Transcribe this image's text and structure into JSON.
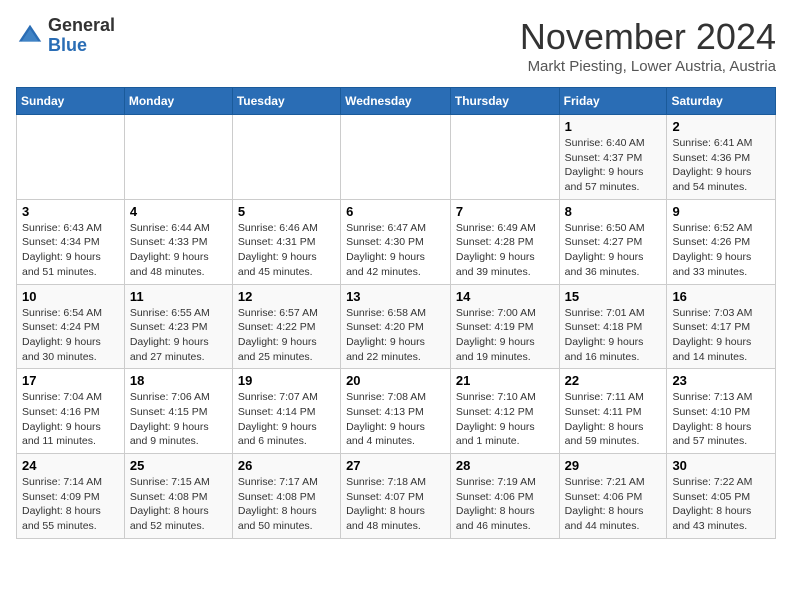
{
  "logo": {
    "general": "General",
    "blue": "Blue"
  },
  "header": {
    "month": "November 2024",
    "location": "Markt Piesting, Lower Austria, Austria"
  },
  "weekdays": [
    "Sunday",
    "Monday",
    "Tuesday",
    "Wednesday",
    "Thursday",
    "Friday",
    "Saturday"
  ],
  "weeks": [
    [
      {
        "day": "",
        "info": ""
      },
      {
        "day": "",
        "info": ""
      },
      {
        "day": "",
        "info": ""
      },
      {
        "day": "",
        "info": ""
      },
      {
        "day": "",
        "info": ""
      },
      {
        "day": "1",
        "info": "Sunrise: 6:40 AM\nSunset: 4:37 PM\nDaylight: 9 hours and 57 minutes."
      },
      {
        "day": "2",
        "info": "Sunrise: 6:41 AM\nSunset: 4:36 PM\nDaylight: 9 hours and 54 minutes."
      }
    ],
    [
      {
        "day": "3",
        "info": "Sunrise: 6:43 AM\nSunset: 4:34 PM\nDaylight: 9 hours and 51 minutes."
      },
      {
        "day": "4",
        "info": "Sunrise: 6:44 AM\nSunset: 4:33 PM\nDaylight: 9 hours and 48 minutes."
      },
      {
        "day": "5",
        "info": "Sunrise: 6:46 AM\nSunset: 4:31 PM\nDaylight: 9 hours and 45 minutes."
      },
      {
        "day": "6",
        "info": "Sunrise: 6:47 AM\nSunset: 4:30 PM\nDaylight: 9 hours and 42 minutes."
      },
      {
        "day": "7",
        "info": "Sunrise: 6:49 AM\nSunset: 4:28 PM\nDaylight: 9 hours and 39 minutes."
      },
      {
        "day": "8",
        "info": "Sunrise: 6:50 AM\nSunset: 4:27 PM\nDaylight: 9 hours and 36 minutes."
      },
      {
        "day": "9",
        "info": "Sunrise: 6:52 AM\nSunset: 4:26 PM\nDaylight: 9 hours and 33 minutes."
      }
    ],
    [
      {
        "day": "10",
        "info": "Sunrise: 6:54 AM\nSunset: 4:24 PM\nDaylight: 9 hours and 30 minutes."
      },
      {
        "day": "11",
        "info": "Sunrise: 6:55 AM\nSunset: 4:23 PM\nDaylight: 9 hours and 27 minutes."
      },
      {
        "day": "12",
        "info": "Sunrise: 6:57 AM\nSunset: 4:22 PM\nDaylight: 9 hours and 25 minutes."
      },
      {
        "day": "13",
        "info": "Sunrise: 6:58 AM\nSunset: 4:20 PM\nDaylight: 9 hours and 22 minutes."
      },
      {
        "day": "14",
        "info": "Sunrise: 7:00 AM\nSunset: 4:19 PM\nDaylight: 9 hours and 19 minutes."
      },
      {
        "day": "15",
        "info": "Sunrise: 7:01 AM\nSunset: 4:18 PM\nDaylight: 9 hours and 16 minutes."
      },
      {
        "day": "16",
        "info": "Sunrise: 7:03 AM\nSunset: 4:17 PM\nDaylight: 9 hours and 14 minutes."
      }
    ],
    [
      {
        "day": "17",
        "info": "Sunrise: 7:04 AM\nSunset: 4:16 PM\nDaylight: 9 hours and 11 minutes."
      },
      {
        "day": "18",
        "info": "Sunrise: 7:06 AM\nSunset: 4:15 PM\nDaylight: 9 hours and 9 minutes."
      },
      {
        "day": "19",
        "info": "Sunrise: 7:07 AM\nSunset: 4:14 PM\nDaylight: 9 hours and 6 minutes."
      },
      {
        "day": "20",
        "info": "Sunrise: 7:08 AM\nSunset: 4:13 PM\nDaylight: 9 hours and 4 minutes."
      },
      {
        "day": "21",
        "info": "Sunrise: 7:10 AM\nSunset: 4:12 PM\nDaylight: 9 hours and 1 minute."
      },
      {
        "day": "22",
        "info": "Sunrise: 7:11 AM\nSunset: 4:11 PM\nDaylight: 8 hours and 59 minutes."
      },
      {
        "day": "23",
        "info": "Sunrise: 7:13 AM\nSunset: 4:10 PM\nDaylight: 8 hours and 57 minutes."
      }
    ],
    [
      {
        "day": "24",
        "info": "Sunrise: 7:14 AM\nSunset: 4:09 PM\nDaylight: 8 hours and 55 minutes."
      },
      {
        "day": "25",
        "info": "Sunrise: 7:15 AM\nSunset: 4:08 PM\nDaylight: 8 hours and 52 minutes."
      },
      {
        "day": "26",
        "info": "Sunrise: 7:17 AM\nSunset: 4:08 PM\nDaylight: 8 hours and 50 minutes."
      },
      {
        "day": "27",
        "info": "Sunrise: 7:18 AM\nSunset: 4:07 PM\nDaylight: 8 hours and 48 minutes."
      },
      {
        "day": "28",
        "info": "Sunrise: 7:19 AM\nSunset: 4:06 PM\nDaylight: 8 hours and 46 minutes."
      },
      {
        "day": "29",
        "info": "Sunrise: 7:21 AM\nSunset: 4:06 PM\nDaylight: 8 hours and 44 minutes."
      },
      {
        "day": "30",
        "info": "Sunrise: 7:22 AM\nSunset: 4:05 PM\nDaylight: 8 hours and 43 minutes."
      }
    ]
  ]
}
